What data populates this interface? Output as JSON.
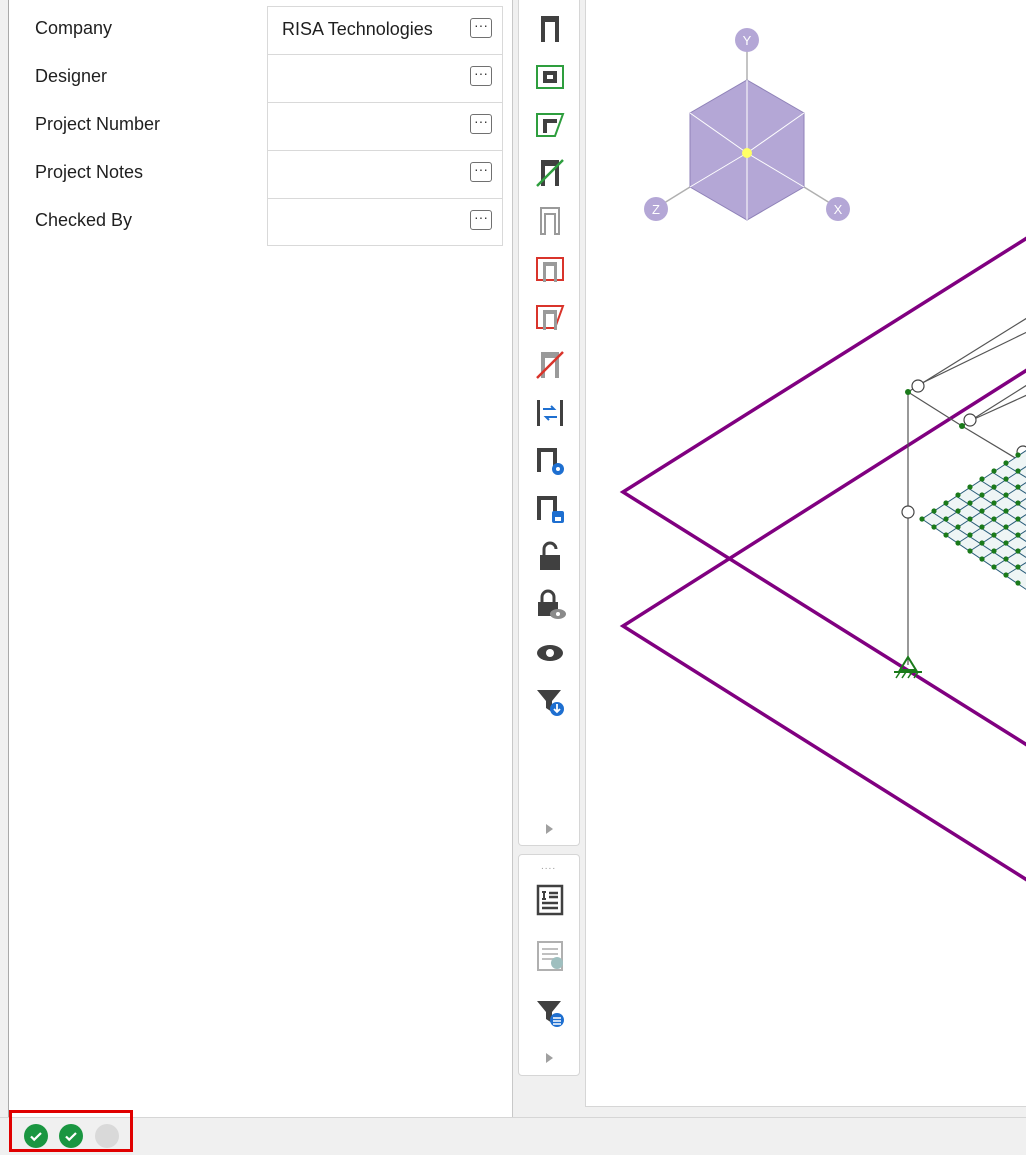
{
  "properties": [
    {
      "label": "Company",
      "value": "RISA Technologies"
    },
    {
      "label": "Designer",
      "value": ""
    },
    {
      "label": "Project Number",
      "value": ""
    },
    {
      "label": "Project Notes",
      "value": ""
    },
    {
      "label": "Checked By",
      "value": ""
    }
  ],
  "ellipsis_label": "···",
  "view_cube": {
    "axis_y": "Y",
    "axis_x": "X",
    "axis_z": "Z",
    "face_color": "#b4a7d6",
    "axis_badge_color": "#b4a7d6"
  },
  "model": {
    "slab_outline_color": "#800080",
    "node_color": "#1a7a1a"
  },
  "toolbar": {
    "icons": [
      "member-icon",
      "member-box-icon",
      "member-box-corner-icon",
      "member-slash-icon",
      "member-gray-icon",
      "member-red-box-icon",
      "member-red-corner-icon",
      "member-red-slash-icon",
      "split-arrows-icon",
      "member-settings-icon",
      "member-save-icon",
      "unlock-icon",
      "lock-eye-icon",
      "eye-icon",
      "filter-down-icon"
    ],
    "icons2": [
      "report-list-icon",
      "report-gray-icon",
      "filter-list-icon"
    ]
  },
  "status": {
    "indicators": [
      "check-ok",
      "check-ok",
      "idle"
    ],
    "ok_color": "#1a9641",
    "highlight_color": "#e00000"
  }
}
